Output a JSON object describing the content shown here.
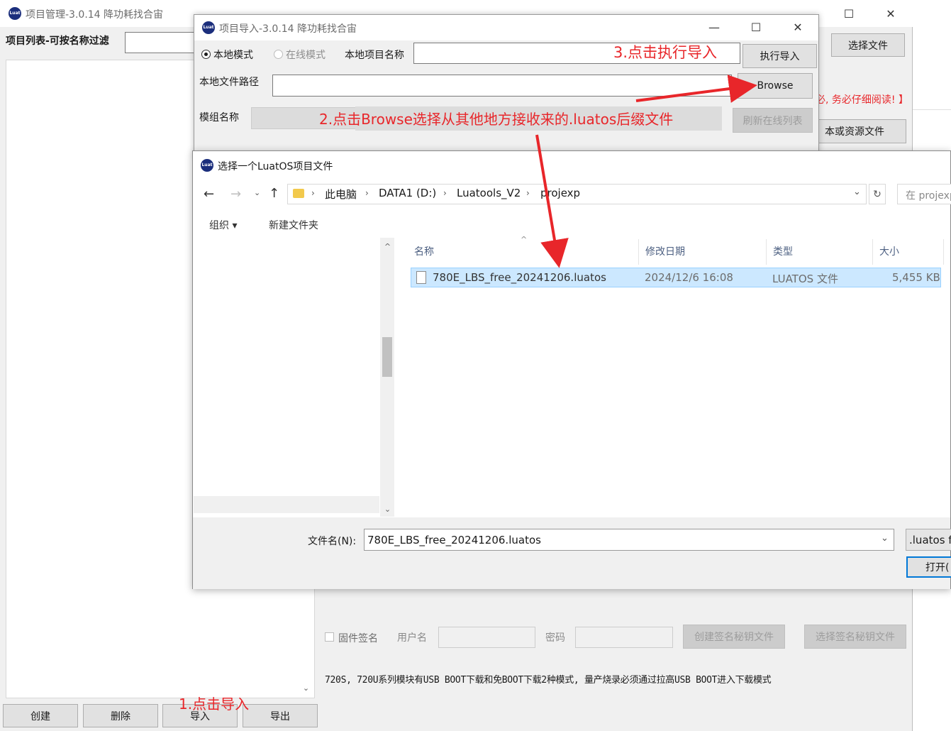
{
  "main_window": {
    "title": "项目管理-3.0.14 降功耗找合宙",
    "filter_label": "项目列表-可按名称过滤",
    "select_file_label": "选择文件",
    "notice_red": "必, 务必仔细阅读! 】",
    "script_file_label": "本或资源文件",
    "firmware_sign_label": "固件签名",
    "username_label": "用户名",
    "password_label": "密码",
    "create_sign_key_label": "创建签名秘钥文件",
    "select_sign_key_label": "选择签名秘钥文件",
    "hint_text": "720S, 720U系列模块有USB BOOT下载和免BOOT下载2种模式, 量产烧录必须通过拉高USB BOOT进入下载模式",
    "buttons": {
      "create": "创建",
      "delete": "删除",
      "import": "导入",
      "export": "导出"
    }
  },
  "import_window": {
    "title": "项目导入-3.0.14 降功耗找合宙",
    "local_mode": "本地模式",
    "online_mode": "在线模式",
    "local_project_name_label": "本地项目名称",
    "execute_import": "执行导入",
    "local_file_path_label": "本地文件路径",
    "browse": "Browse",
    "module_name_label": "模组名称",
    "refresh_online_list": "刷新在线列表"
  },
  "file_dialog": {
    "title": "选择一个LuatOS项目文件",
    "breadcrumb": [
      "此电脑",
      "DATA1 (D:)",
      "Luatools_V2",
      "projexp"
    ],
    "search_placeholder": "在 projexp",
    "organize": "组织 ▾",
    "new_folder": "新建文件夹",
    "columns": {
      "name": "名称",
      "modified": "修改日期",
      "type": "类型",
      "size": "大小"
    },
    "files": [
      {
        "name": "780E_LBS_free_20241206.luatos",
        "modified": "2024/12/6 16:08",
        "type": "LUATOS 文件",
        "size": "5,455 KB"
      }
    ],
    "filename_label": "文件名(N):",
    "filename_value": "780E_LBS_free_20241206.luatos",
    "filter_value": ".luatos fi",
    "open_button": "打开("
  },
  "annotations": {
    "step1": "1.点击导入",
    "step2": "2.点击Browse选择从其他地方接收来的.luatos后缀文件",
    "step3": "3.点击执行导入"
  },
  "colors": {
    "annotation_red": "#e8262a",
    "selection_blue": "#cce8ff"
  }
}
